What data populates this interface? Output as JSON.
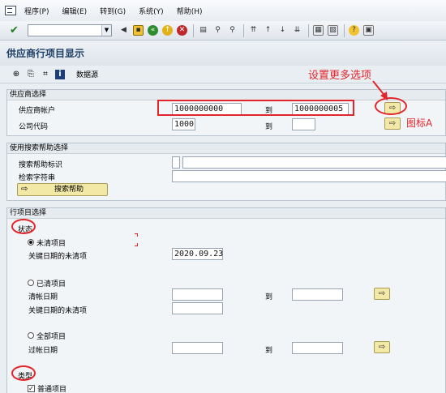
{
  "menu": [
    "程序(P)",
    "编辑(E)",
    "转到(G)",
    "系统(Y)",
    "帮助(H)"
  ],
  "title": "供应商行项目显示",
  "appbar": {
    "label": "数据源"
  },
  "section_vendor": {
    "title": "供应商选择",
    "vendor_account_label": "供应商帐户",
    "vendor_from": "1000000000",
    "to_label": "到",
    "vendor_to": "1000000005",
    "company_code_label": "公司代码",
    "company_code": "1000",
    "to_label2": "到"
  },
  "section_search": {
    "title": "使用搜索帮助选择",
    "help_id_label": "搜索帮助标识",
    "search_string_label": "检索字符串",
    "search_help_button": "搜索帮助"
  },
  "section_items": {
    "title": "行项目选择",
    "status_label": "状态",
    "open_items": "未清项目",
    "open_key_date_label": "关键日期的未清项",
    "open_key_date": "2020.09.23",
    "cleared_items": "已清项目",
    "clearing_date_label": "清帐日期",
    "cleared_key_date_label": "关键日期的未清项",
    "to_label": "到",
    "all_items": "全部项目",
    "posting_date_label": "过帐日期",
    "to_label2": "到",
    "type_label": "类型",
    "normal_items": "普通项目"
  },
  "annotations": {
    "more_options": "设置更多选项",
    "icon_a": "图标A"
  },
  "colors": {
    "annotation": "#e2252b",
    "title": "#1e3f66",
    "button": "#f3e9a7"
  }
}
